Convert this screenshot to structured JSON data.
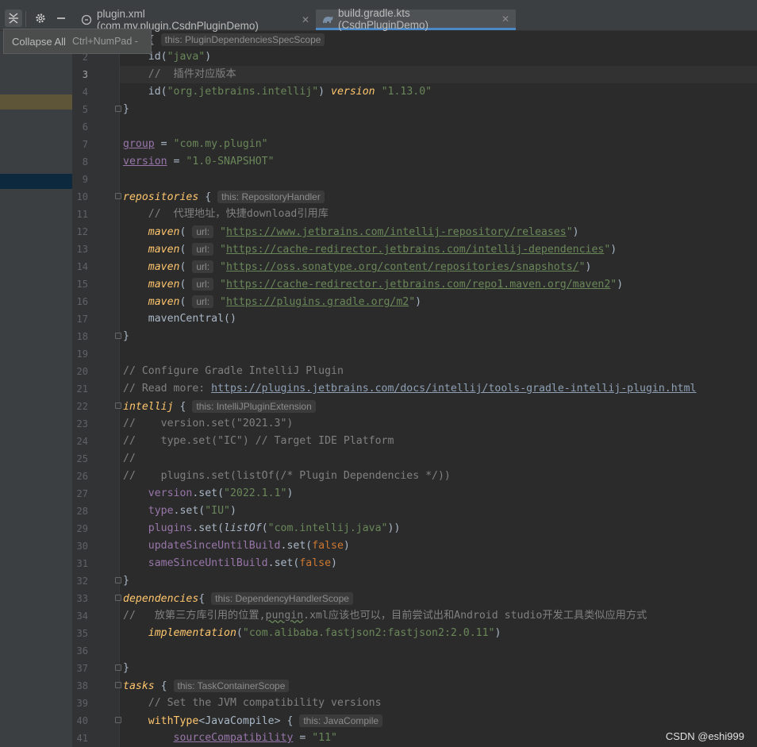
{
  "toolbar": {
    "collapse_icon": "collapse-all-icon",
    "gear_icon": "gear-icon",
    "minimize_icon": "minimize-icon"
  },
  "tabs": [
    {
      "label": "plugin.xml (com.my.plugin.CsdnPluginDemo)",
      "icon": "xml-file-icon",
      "active": false
    },
    {
      "label": "build.gradle.kts (CsdnPluginDemo)",
      "icon": "gradle-icon",
      "active": true
    }
  ],
  "tooltip": {
    "title": "Collapse All",
    "shortcut": "Ctrl+NumPad -"
  },
  "editor": {
    "current_line": 3,
    "line_numbers": [
      "",
      "2",
      "3",
      "4",
      "5",
      "6",
      "7",
      "8",
      "9",
      "10",
      "11",
      "12",
      "13",
      "14",
      "15",
      "16",
      "17",
      "18",
      "19",
      "20",
      "21",
      "22",
      "23",
      "24",
      "25",
      "26",
      "27",
      "28",
      "29",
      "30",
      "31",
      "32",
      "33",
      "34",
      "35",
      "36",
      "37",
      "38",
      "39",
      "40",
      "41"
    ],
    "tokens": {
      "l1_code": "ins { ",
      "l1_hint": "this: PluginDependenciesSpecScope",
      "l2_id": "id(",
      "l2_str": "\"java\"",
      "l2_end": ")",
      "l3_comment": "//  插件对应版本",
      "l4_id": "id(",
      "l4_str": "\"org.jetbrains.intellij\"",
      "l4_mid": ") ",
      "l4_kw": "version",
      "l4_str2": " \"1.13.0\"",
      "brace_close": "}",
      "l7_prop": "group",
      "l7_eq": " = ",
      "l7_str": "\"com.my.plugin\"",
      "l8_prop": "version",
      "l8_eq": " = ",
      "l8_str": "\"1.0-SNAPSHOT\"",
      "l10_fn": "repositories",
      "l10_brace": " { ",
      "l10_hint": "this: RepositoryHandler",
      "l11_comment": "//  代理地址，快捷download引用库",
      "maven": "maven",
      "paren_open": "(",
      "url_hint": "url:",
      "quote": "\"",
      "paren_close": ")",
      "l12_url": "https://www.jetbrains.com/intellij-repository/releases",
      "l13_url": "https://cache-redirector.jetbrains.com/intellij-dependencies",
      "l14_url": "https://oss.sonatype.org/content/repositories/snapshots/",
      "l15_url": "https://cache-redirector.jetbrains.com/repo1.maven.org/maven2",
      "l16_url": "https://plugins.gradle.org/m2",
      "l17_code": "mavenCentral()",
      "l20_comment": "// Configure Gradle IntelliJ Plugin",
      "l21_comment": "// Read more: ",
      "l21_url": "https://plugins.jetbrains.com/docs/intellij/tools-gradle-intellij-plugin.html",
      "l22_fn": "intellij",
      "l22_brace": " { ",
      "l22_hint": "this: IntelliJPluginExtension",
      "l23_comment": "//    version.set(\"2021.3\")",
      "l24_comment": "//    type.set(\"IC\") // Target IDE Platform",
      "l25_comment": "//",
      "l26_comment": "//    plugins.set(listOf(/* Plugin Dependencies */))",
      "l27_prop": "version",
      "l27_code": ".set(",
      "l27_str": "\"2022.1.1\"",
      "l27_end": ")",
      "l28_prop": "type",
      "l28_code": ".set(",
      "l28_str": "\"IU\"",
      "l28_end": ")",
      "l29_prop": "plugins",
      "l29_code": ".set(",
      "l29_fn": "listOf",
      "l29_p": "(",
      "l29_str": "\"com.intellij.java\"",
      "l29_end": "))",
      "l30_prop": "updateSinceUntilBuild",
      "l30_code": ".set(",
      "l30_kw": "false",
      "l30_end": ")",
      "l31_prop": "sameSinceUntilBuild",
      "l31_code": ".set(",
      "l31_kw": "false",
      "l31_end": ")",
      "l33_fn": "dependencies",
      "l33_brace": "{ ",
      "l33_hint": "this: DependencyHandlerScope",
      "l34_comment_a": "//   放第三方库引用的位置,",
      "l34_comment_b": "pungin",
      "l34_comment_c": ".xml应该也可以，目前尝试出和Android studio开发工具类似应用方式",
      "l35_fn": "implementation",
      "l35_p": "(",
      "l35_str": "\"com.alibaba.fastjson2:fastjson2:2.0.11\"",
      "l35_end": ")",
      "l38_fn": "tasks",
      "l38_brace": " { ",
      "l38_hint": "this: TaskContainerScope",
      "l39_comment": "// Set the JVM compatibility versions",
      "l40_fn": "withType",
      "l40_code": "<JavaCompile> { ",
      "l40_hint": "this: JavaCompile",
      "l41_prop": "sourceCompatibility",
      "l41_eq": " = ",
      "l41_str": "\"11\""
    }
  },
  "watermark": "CSDN @eshi999"
}
